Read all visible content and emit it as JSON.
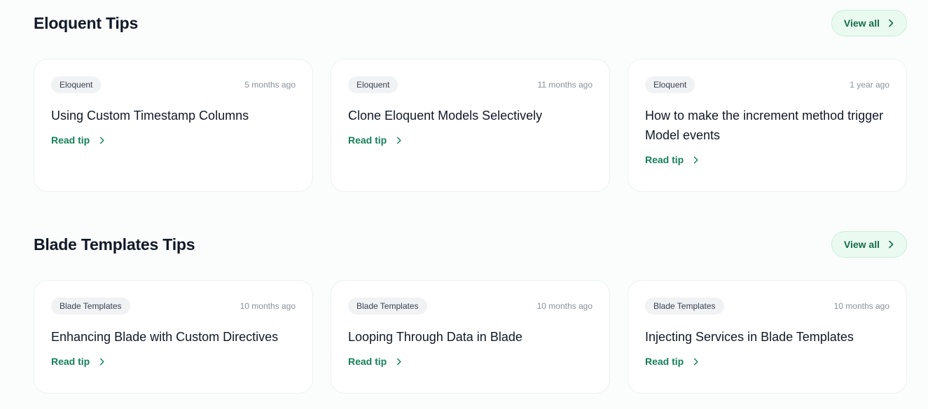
{
  "sections": [
    {
      "title": "Eloquent Tips",
      "view_all_label": "View all",
      "cards": [
        {
          "badge": "Eloquent",
          "time": "5 months ago",
          "title": "Using Custom Timestamp Columns",
          "link": "Read tip"
        },
        {
          "badge": "Eloquent",
          "time": "11 months ago",
          "title": "Clone Eloquent Models Selectively",
          "link": "Read tip"
        },
        {
          "badge": "Eloquent",
          "time": "1 year ago",
          "title": "How to make the increment method trigger Model events",
          "link": "Read tip"
        }
      ]
    },
    {
      "title": "Blade Templates Tips",
      "view_all_label": "View all",
      "cards": [
        {
          "badge": "Blade Templates",
          "time": "10 months ago",
          "title": "Enhancing Blade with Custom Directives",
          "link": "Read tip"
        },
        {
          "badge": "Blade Templates",
          "time": "10 months ago",
          "title": "Looping Through Data in Blade",
          "link": "Read tip"
        },
        {
          "badge": "Blade Templates",
          "time": "10 months ago",
          "title": "Injecting Services in Blade Templates",
          "link": "Read tip"
        }
      ]
    }
  ],
  "icons": {
    "chevron": "chevron-right-icon"
  },
  "colors": {
    "accent": "#15805a",
    "accent_bg": "#eafaf1"
  }
}
